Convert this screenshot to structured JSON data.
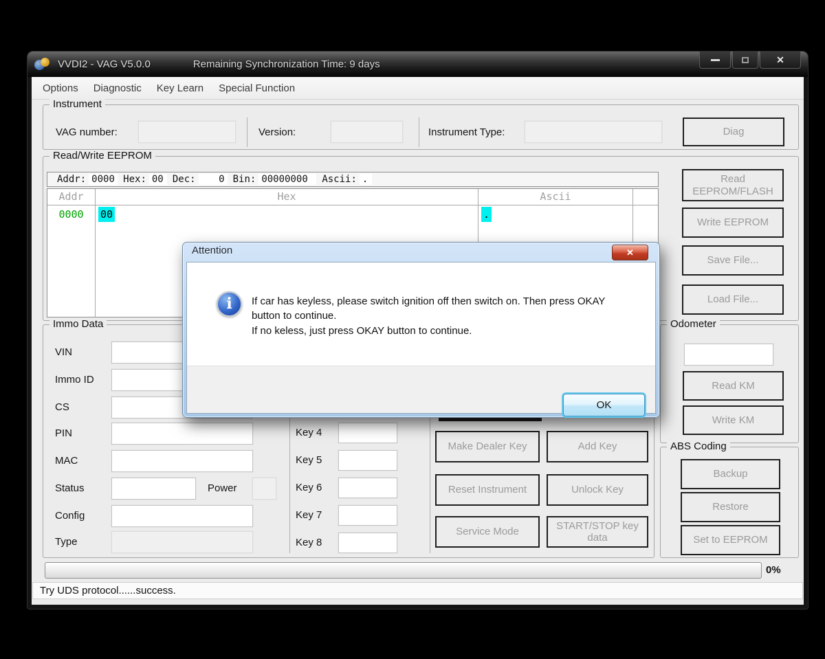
{
  "window": {
    "title": "VVDI2 - VAG V5.0.0",
    "sync_time": "Remaining Synchronization Time: 9 days",
    "close_glyph": "✕"
  },
  "menu": {
    "items": [
      "Options",
      "Diagnostic",
      "Key Learn",
      "Special Function"
    ]
  },
  "instrument": {
    "legend": "Instrument",
    "vag_number_label": "VAG number:",
    "vag_number_value": "",
    "version_label": "Version:",
    "version_value": "",
    "type_label": "Instrument Type:",
    "type_value": "",
    "diag_button": "Diag"
  },
  "eeprom": {
    "legend": "Read/Write EEPROM",
    "info": {
      "addr_label": "Addr:",
      "addr": "0000",
      "hex_label": "Hex:",
      "hex": "00",
      "dec_label": "Dec:",
      "dec": "0",
      "bin_label": "Bin:",
      "bin": "00000000",
      "ascii_label": "Ascii:",
      "ascii": "."
    },
    "table": {
      "headers": {
        "addr": "Addr",
        "hex": "Hex",
        "ascii": "Ascii"
      },
      "row": {
        "addr": "0000",
        "hex": "00",
        "ascii": "."
      }
    },
    "buttons": {
      "read": "Read EEPROM/FLASH",
      "write": "Write EEPROM",
      "save": "Save File...",
      "load": "Load File..."
    }
  },
  "immo": {
    "legend": "Immo Data",
    "fields": [
      {
        "label": "VIN",
        "value": ""
      },
      {
        "label": "Immo ID",
        "value": ""
      },
      {
        "label": "CS",
        "value": ""
      },
      {
        "label": "PIN",
        "value": ""
      },
      {
        "label": "MAC",
        "value": ""
      },
      {
        "label": "Status",
        "value": ""
      },
      {
        "label": "Config",
        "value": ""
      },
      {
        "label": "Type",
        "value": ""
      }
    ],
    "power_label": "Power",
    "keys": [
      {
        "label": "Key 4",
        "value": ""
      },
      {
        "label": "Key 5",
        "value": ""
      },
      {
        "label": "Key 6",
        "value": ""
      },
      {
        "label": "Key 7",
        "value": ""
      },
      {
        "label": "Key 8",
        "value": ""
      }
    ],
    "actions": {
      "make_dealer_key": "Make Dealer Key",
      "add_key": "Add Key",
      "reset_instrument": "Reset Instrument",
      "unlock_key": "Unlock Key",
      "service_mode": "Service Mode",
      "start_stop_key_data": "START/STOP key data"
    }
  },
  "odometer": {
    "legend": "Odometer",
    "value": "",
    "read_km": "Read KM",
    "write_km": "Write KM"
  },
  "abs_coding": {
    "legend": "ABS Coding",
    "backup": "Backup",
    "restore": "Restore",
    "set_to_eeprom": "Set to EEPROM"
  },
  "progress": {
    "percent": "0%"
  },
  "status_bar": {
    "text": "Try UDS protocol......success."
  },
  "dialog": {
    "title": "Attention",
    "close_glyph": "✕",
    "info_icon_glyph": "i",
    "message_line1": "If car has keyless, please switch ignition off then switch on. Then press OKAY button to continue.",
    "message_line2": "If no keless, just press OKAY button to continue.",
    "ok_button": "OK"
  },
  "colors": {
    "selection_cyan": "#00f0f0",
    "addr_green": "#00a400",
    "dialog_accent_blue": "#b4d1ee",
    "close_red": "#c03a22"
  }
}
